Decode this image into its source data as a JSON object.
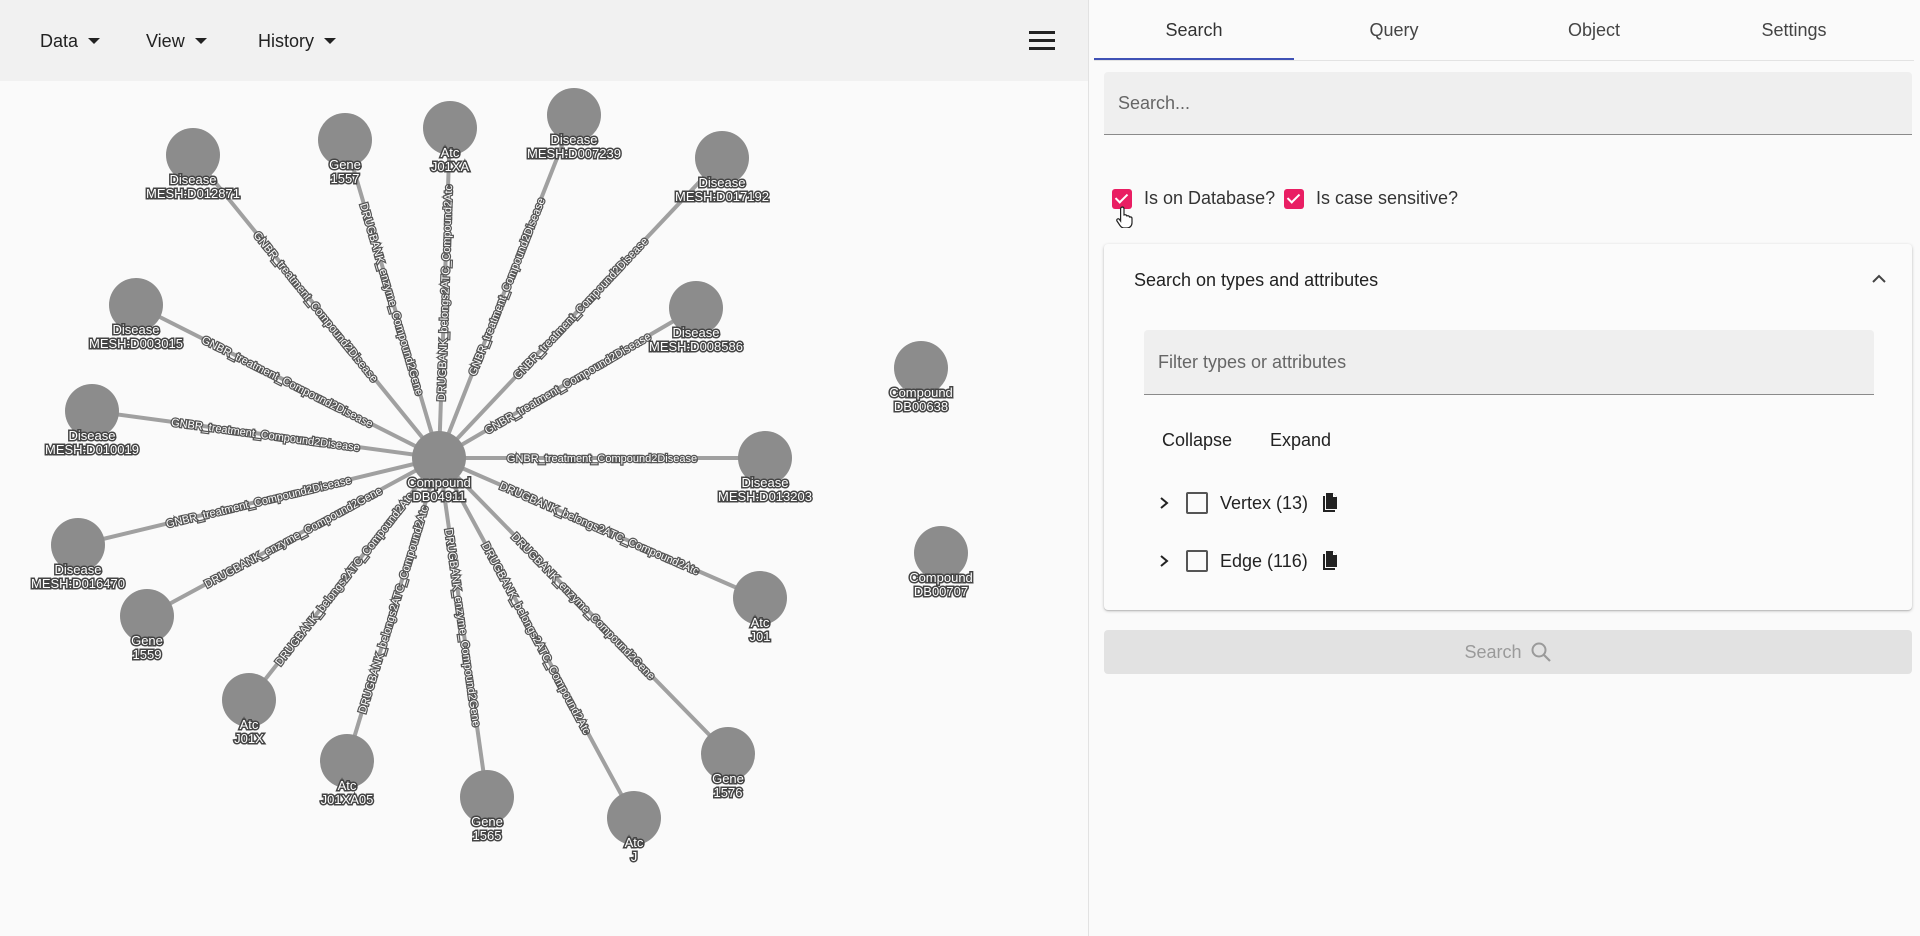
{
  "menubar": {
    "data_label": "Data",
    "view_label": "View",
    "history_label": "History"
  },
  "tabs": [
    "Search",
    "Query",
    "Object",
    "Settings"
  ],
  "search": {
    "placeholder": "Search...",
    "value": ""
  },
  "options": {
    "on_database_label": "Is on Database?",
    "on_database_checked": true,
    "case_sensitive_label": "Is case sensitive?",
    "case_sensitive_checked": true
  },
  "attributes_panel": {
    "title": "Search on types and attributes",
    "filter_placeholder": "Filter types or attributes",
    "collapse_label": "Collapse",
    "expand_label": "Expand",
    "tree": [
      {
        "label": "Vertex (13)",
        "checked": false
      },
      {
        "label": "Edge (116)",
        "checked": false
      }
    ]
  },
  "search_button_label": "Search",
  "colors": {
    "accent": "#3f51b5",
    "checkbox": "#e91e63",
    "node": "#8c8c8c",
    "edge": "#a0a0a0"
  },
  "graph": {
    "center": {
      "id": "c",
      "type": "Compound",
      "name": "DB04911"
    },
    "nodes": [
      {
        "id": "n1",
        "type": "Disease",
        "name": "MESH:D012871"
      },
      {
        "id": "n2",
        "type": "Gene",
        "name": "1557"
      },
      {
        "id": "n3",
        "type": "Atc",
        "name": "J01XA"
      },
      {
        "id": "n4",
        "type": "Disease",
        "name": "MESH:D007239"
      },
      {
        "id": "n5",
        "type": "Disease",
        "name": "MESH:D017192"
      },
      {
        "id": "n6",
        "type": "Disease",
        "name": "MESH:D003015"
      },
      {
        "id": "n7",
        "type": "Disease",
        "name": "MESH:D008586"
      },
      {
        "id": "n8",
        "type": "Disease",
        "name": "MESH:D010019"
      },
      {
        "id": "n9",
        "type": "Disease",
        "name": "MESH:D013203"
      },
      {
        "id": "n10",
        "type": "Disease",
        "name": "MESH:D016470"
      },
      {
        "id": "n11",
        "type": "Gene",
        "name": "1559"
      },
      {
        "id": "n12",
        "type": "Atc",
        "name": "J01"
      },
      {
        "id": "n13",
        "type": "Atc",
        "name": "J01X"
      },
      {
        "id": "n14",
        "type": "Atc",
        "name": "J01XA05"
      },
      {
        "id": "n15",
        "type": "Gene",
        "name": "1565"
      },
      {
        "id": "n16",
        "type": "Atc",
        "name": "J"
      },
      {
        "id": "n17",
        "type": "Gene",
        "name": "1576"
      },
      {
        "id": "n18",
        "type": "Compound",
        "name": "DB00638"
      },
      {
        "id": "n19",
        "type": "Compound",
        "name": "DB00707"
      }
    ],
    "edges": [
      {
        "target": "n1",
        "label": "GNBR_treatment_Compound2Disease"
      },
      {
        "target": "n2",
        "label": "DRUGBANK_enzyme_Compound2Gene"
      },
      {
        "target": "n3",
        "label": "DRUGBANK_belongs2ATC_Compound2Atc"
      },
      {
        "target": "n4",
        "label": "GNBR_treatment_Compound2Disease"
      },
      {
        "target": "n5",
        "label": "GNBR_treatment_Compound2Disease"
      },
      {
        "target": "n6",
        "label": "GNBR_treatment_Compound2Disease"
      },
      {
        "target": "n7",
        "label": "GNBR_treatment_Compound2Disease"
      },
      {
        "target": "n8",
        "label": "GNBR_treatment_Compound2Disease"
      },
      {
        "target": "n9",
        "label": "GNBR_treatment_Compound2Disease"
      },
      {
        "target": "n10",
        "label": "GNBR_treatment_Compound2Disease"
      },
      {
        "target": "n11",
        "label": "DRUGBANK_enzyme_Compound2Gene"
      },
      {
        "target": "n12",
        "label": "DRUGBANK_belongs2ATC_Compound2Atc"
      },
      {
        "target": "n13",
        "label": "DRUGBANK_belongs2ATC_Compound2Atc"
      },
      {
        "target": "n14",
        "label": "DRUGBANK_belongs2ATC_Compound2Atc"
      },
      {
        "target": "n15",
        "label": "DRUGBANK_enzyme_Compound2Gene"
      },
      {
        "target": "n16",
        "label": "DRUGBANK_belongs2ATC_Compound2Atc"
      },
      {
        "target": "n17",
        "label": "DRUGBANK_enzyme_Compound2Gene"
      }
    ]
  }
}
